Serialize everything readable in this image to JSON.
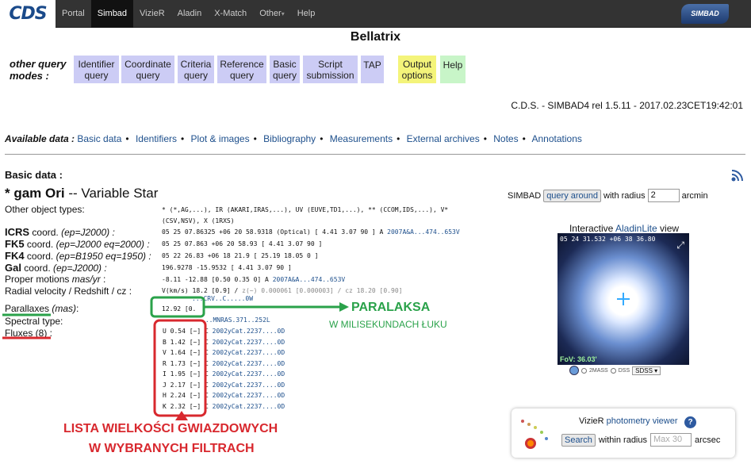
{
  "navbar": {
    "logo": "CDS",
    "items": [
      "Portal",
      "Simbad",
      "VizieR",
      "Aladin",
      "X-Match",
      "Other",
      "Help"
    ],
    "active": "Simbad",
    "other_caret": "▾",
    "simbad_logo": "SIMBAD"
  },
  "page_title": "Bellatrix",
  "query_modes": {
    "label_line1": "other query",
    "label_line2": "modes :",
    "buttons": [
      {
        "l1": "Identifier",
        "l2": "query"
      },
      {
        "l1": "Coordinate",
        "l2": "query"
      },
      {
        "l1": "Criteria",
        "l2": "query"
      },
      {
        "l1": "Reference",
        "l2": "query"
      },
      {
        "l1": "Basic",
        "l2": "query"
      },
      {
        "l1": "Script",
        "l2": "submission"
      },
      {
        "l1": "TAP",
        "l2": ""
      },
      {
        "l1": "Output",
        "l2": "options"
      },
      {
        "l1": "Help",
        "l2": ""
      }
    ]
  },
  "version": "C.D.S. - SIMBAD4 rel 1.5.11 - 2017.02.23CET19:42:01",
  "available": {
    "label": "Available data :",
    "links": [
      "Basic data",
      "Identifiers",
      "Plot & images",
      "Bibliography",
      "Measurements",
      "External archives",
      "Notes",
      "Annotations"
    ],
    "sep": "•"
  },
  "basic": {
    "title": "Basic data :",
    "name_prefix": "* gam Ori",
    "name_suffix": " -- Variable Star",
    "other_types_label": "Other object types:",
    "other_types_l1": "* (*,AG,...), IR (AKARI,IRAS,...), UV (EUVE,TD1,...), ** (CCOM,IDS,...), V*",
    "other_types_l2": "(CSV,NSV), X (1RXS)",
    "icrs": {
      "b": "ICRS",
      "rest": " coord. ",
      "it": "(ep=J2000) :",
      "val": "05 25 07.86325 +06 20 58.9318 (Optical) [ 4.41 3.07 90 ] A ",
      "ref": "2007A&A...474..653V"
    },
    "fk5": {
      "b": "FK5",
      "rest": " coord. ",
      "it": "(ep=J2000 eq=2000) :",
      "val": "05 25 07.863 +06 20 58.93 [ 4.41 3.07 90 ]"
    },
    "fk4": {
      "b": "FK4",
      "rest": " coord. ",
      "it": "(ep=B1950 eq=1950) :",
      "val": "05 22 26.83 +06 18 21.9 [ 25.19 18.05 0 ]"
    },
    "gal": {
      "b": "Gal",
      "rest": " coord. ",
      "it": "(ep=J2000) :",
      "val": "196.9278 -15.9532 [ 4.41 3.07 90 ]"
    },
    "pm": {
      "label": "Proper motions ",
      "it": "mas/yr",
      "end": " :",
      "val": "-8.11 -12.88 [0.50 0.35 0] A ",
      "ref": "2007A&A...474..653V"
    },
    "rv": {
      "label": "Radial velocity / Redshift / cz :",
      "val": "V(km/s) 18.2 [0.9] / ",
      "val_grey": "z(~) 0.000061 [0.000003] / cz 18.20 [0.90]",
      "val2": "...CRV..C.....0W"
    },
    "plx": {
      "label": "Parallaxes ",
      "it": "(mas)",
      "end": ":",
      "val": "12.92 [0.",
      "ref": "...MNRAS.371..252L"
    },
    "sptype": {
      "label": "Spectral type:"
    },
    "fluxes": {
      "label": "Fluxes (8) :",
      "rows": [
        {
          "band": "U",
          "val": "0.54 [~] C ",
          "ref": "2002yCat.2237....0D"
        },
        {
          "band": "B",
          "val": "1.42 [~] C ",
          "ref": "2002yCat.2237....0D"
        },
        {
          "band": "V",
          "val": "1.64 [~] C ",
          "ref": "2002yCat.2237....0D"
        },
        {
          "band": "R",
          "val": "1.73 [~] C ",
          "ref": "2002yCat.2237....0D"
        },
        {
          "band": "I",
          "val": "1.95 [~] C ",
          "ref": "2002yCat.2237....0D"
        },
        {
          "band": "J",
          "val": "2.17 [~] C ",
          "ref": "2002yCat.2237....0D"
        },
        {
          "band": "H",
          "val": "2.24 [~] C ",
          "ref": "2002yCat.2237....0D"
        },
        {
          "band": "K",
          "val": "2.32 [~] C ",
          "ref": "2002yCat.2237....0D"
        }
      ]
    }
  },
  "annotations": {
    "paralaksa": "PARALAKSA",
    "mili": "W MILISEKUNDACH ŁUKU",
    "lista1": "LISTA WIELKOŚCI GWIAZDOWYCH",
    "lista2": "W WYBRANYCH FILTRACH",
    "green": "#2aa24a",
    "red": "#d8282e"
  },
  "side": {
    "simbad": "SIMBAD",
    "query_around": "query around",
    "with_radius": "with radius",
    "radius_value": "2",
    "arcmin": "arcmin",
    "aladin_prefix": "Interactive ",
    "aladin_link": "AladinLite",
    "aladin_suffix": " view",
    "aladin_coord": "05 24 31.532 +06 38 36.80",
    "fov": "FoV: 36.03'",
    "surveys": [
      "2MASS",
      "DSS"
    ],
    "survey_select": "SDSS",
    "vizier_prefix": "VizieR ",
    "vizier_link": "photometry viewer",
    "help": "?",
    "search": "Search",
    "within_radius": "within radius",
    "within_placeholder": "Max 30",
    "arcsec": "arcsec"
  }
}
